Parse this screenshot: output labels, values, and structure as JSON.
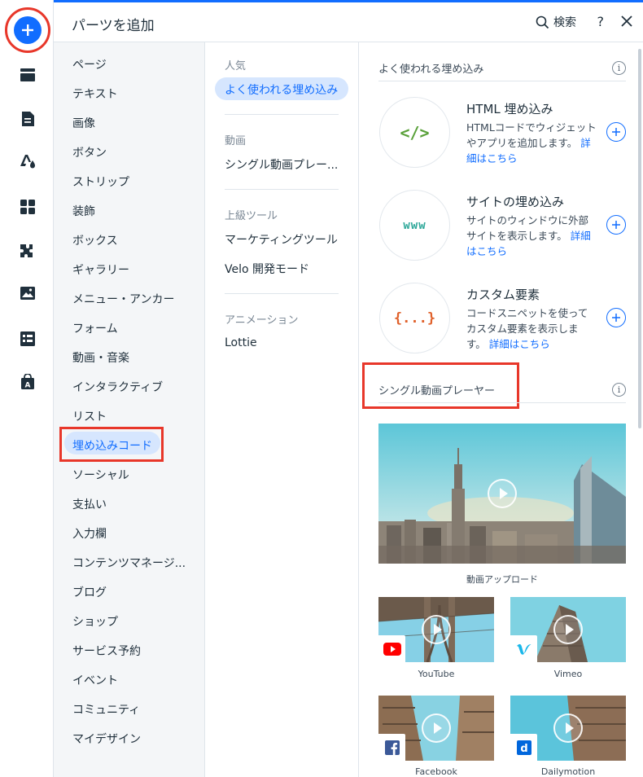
{
  "header": {
    "title": "パーツを追加",
    "search_label": "検索",
    "help_label": "?"
  },
  "rail": {
    "items": [
      "add-icon",
      "sections-icon",
      "pages-icon",
      "design-icon",
      "apps-icon",
      "business-icon",
      "media-icon",
      "cms-icon",
      "portfolio-icon"
    ]
  },
  "categories": [
    "ページ",
    "テキスト",
    "画像",
    "ボタン",
    "ストリップ",
    "装飾",
    "ボックス",
    "ギャラリー",
    "メニュー・アンカー",
    "フォーム",
    "動画・音楽",
    "インタラクティブ",
    "リスト",
    "埋め込みコード",
    "ソーシャル",
    "支払い",
    "入力欄",
    "コンテンツマネージ...",
    "ブログ",
    "ショップ",
    "サービス予約",
    "イベント",
    "コミュニティ",
    "マイデザイン"
  ],
  "subcategories": {
    "popular_head": "人気",
    "popular_item": "よく使われる埋め込み",
    "video_head": "動画",
    "video_item": "シングル動画プレー...",
    "advanced_head": "上級ツール",
    "advanced_items": [
      "マーケティングツール",
      "Velo 開発モード"
    ],
    "animation_head": "アニメーション",
    "animation_item": "Lottie"
  },
  "content": {
    "section1_title": "よく使われる埋め込み",
    "embeds": [
      {
        "title": "HTML 埋め込み",
        "desc": "HTMLコードでウィジェットやアプリを追加します。",
        "link": "詳細はこちら",
        "icon": "</>"
      },
      {
        "title": "サイトの埋め込み",
        "desc": "サイトのウィンドウに外部サイトを表示します。",
        "link": "詳細はこちら",
        "icon": "www"
      },
      {
        "title": "カスタム要素",
        "desc": "コードスニペットを使ってカスタム要素を表示します。",
        "link": "詳細はこちら",
        "icon": "{...}"
      }
    ],
    "section2_title": "シングル動画プレーヤー",
    "videos": [
      {
        "label": "動画アップロード"
      },
      {
        "label": "YouTube"
      },
      {
        "label": "Vimeo"
      },
      {
        "label": "Facebook"
      },
      {
        "label": "Dailymotion"
      }
    ]
  },
  "colors": {
    "accent": "#116dff",
    "highlight_box": "#e8372a",
    "selected_bg": "#d6e6fe",
    "youtube": "#ff0000",
    "vimeo": "#1ab7ea",
    "facebook": "#3b5998",
    "dailymotion": "#0066dc"
  }
}
